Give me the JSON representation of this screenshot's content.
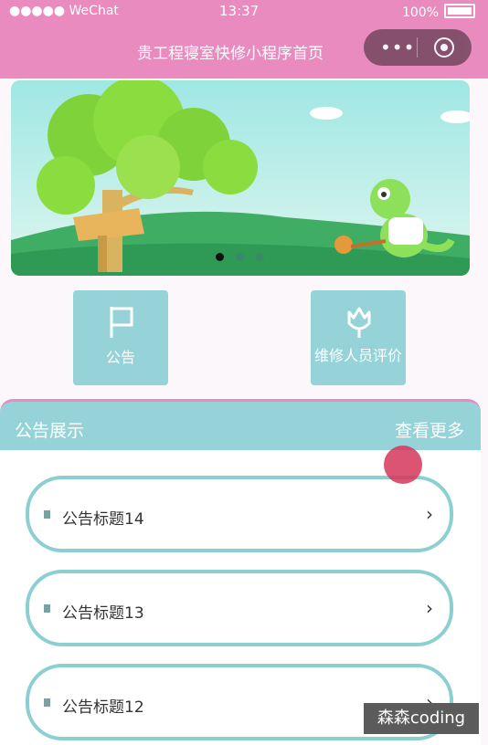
{
  "status_bar": {
    "carrier": "●●●●● WeChat",
    "time": "13:37",
    "battery": "100%"
  },
  "nav": {
    "title": "贵工程寝室快修小程序首页"
  },
  "shortcuts": [
    {
      "label": "公告",
      "icon": "flag-icon"
    },
    {
      "label": "维修人员评价",
      "icon": "flower-icon"
    }
  ],
  "notice_section": {
    "title": "公告展示",
    "more": "查看更多"
  },
  "notices": [
    {
      "title": "公告标题14",
      "chevron": "›"
    },
    {
      "title": "公告标题13",
      "chevron": "›"
    },
    {
      "title": "公告标题12",
      "chevron": "›"
    }
  ],
  "watermark": "森森coding",
  "colors": {
    "nav_bg": "#e98bbf",
    "accent_teal": "#96d3d9",
    "card_border": "#8ccfd1"
  }
}
